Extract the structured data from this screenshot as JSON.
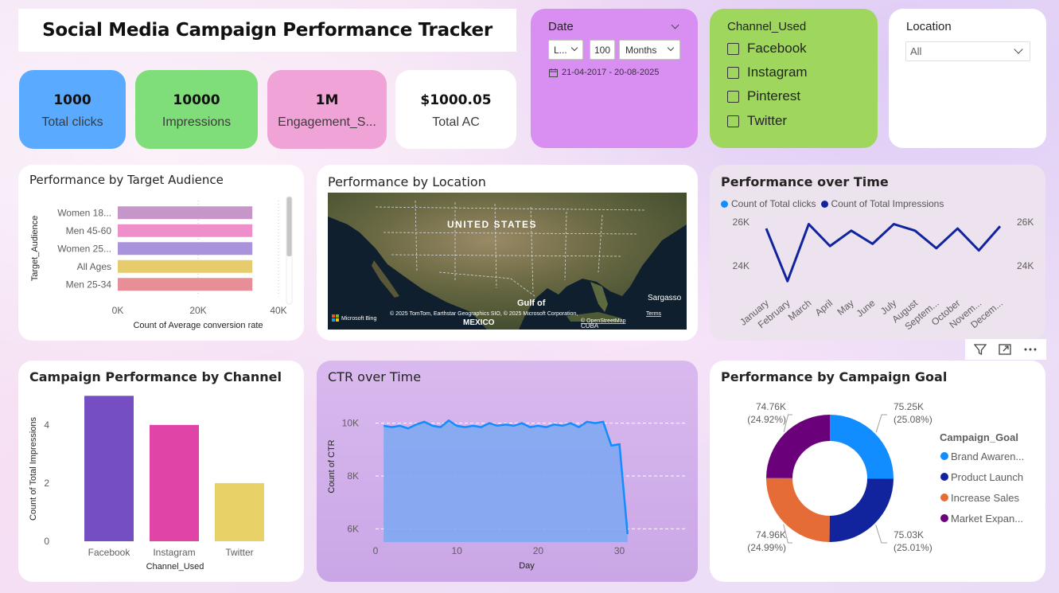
{
  "title": "Social Media Campaign Performance Tracker",
  "kpis": [
    {
      "value": "1000",
      "label": "Total clicks",
      "color": "#5aabff"
    },
    {
      "value": "10000",
      "label": "Impressions",
      "color": "#80de7a"
    },
    {
      "value": "1M",
      "label": "Engagement_S...",
      "color": "#f0a3d6"
    },
    {
      "value": "$1000.05",
      "label": "Total AC",
      "color": "#ffffff"
    }
  ],
  "date_slicer": {
    "title": "Date",
    "mode": "L...",
    "count": "100",
    "unit": "Months",
    "range": "21-04-2017 - 20-08-2025",
    "color": "#d98ff2"
  },
  "channel_slicer": {
    "title": "Channel_Used",
    "options": [
      "Facebook",
      "Instagram",
      "Pinterest",
      "Twitter"
    ],
    "color": "#9ed65e"
  },
  "location_slicer": {
    "title": "Location",
    "selected": "All"
  },
  "visual_headers": {
    "target_audience": "Performance by Target Audience",
    "location": "Performance by Location",
    "over_time": "Performance over Time",
    "channel": "Campaign Performance by Channel",
    "ctr": "CTR over Time",
    "goal": "Performance by Campaign Goal"
  },
  "map": {
    "country_label": "UNITED STATES",
    "gulf_label": "Gulf of",
    "mexico_label": "MEXICO",
    "cuba_label": "CUBA",
    "sargasso_label": "Sargasso",
    "attribution": "© 2025 TomTom, Earthstar Geographics SIO, © 2025 Microsoft Corporation,",
    "osm": "© OpenStreetMap",
    "terms": "Terms",
    "bing": "Microsoft Bing"
  },
  "visual_icons": [
    "filter-icon",
    "focus-mode-icon",
    "more-options-icon"
  ],
  "chart_data": [
    {
      "id": "target_audience",
      "type": "bar",
      "orientation": "horizontal",
      "title": "Performance by Target Audience",
      "categories": [
        "Women 18...",
        "Men 45-60",
        "Women 25...",
        "All Ages",
        "Men 25-34"
      ],
      "values": [
        33500,
        33500,
        33500,
        33500,
        33500
      ],
      "colors": [
        "#c796c9",
        "#ee8fcb",
        "#a994dc",
        "#e6cc6c",
        "#e88e97"
      ],
      "xlabel": "Count of Average conversion rate",
      "ylabel": "Target_Audience",
      "xticks": [
        "0K",
        "20K",
        "40K"
      ],
      "xlim": [
        0,
        40000
      ]
    },
    {
      "id": "over_time",
      "type": "line",
      "title": "Performance over Time",
      "categories": [
        "January",
        "February",
        "March",
        "April",
        "May",
        "June",
        "July",
        "August",
        "Septem...",
        "October",
        "Novem...",
        "Decem..."
      ],
      "series": [
        {
          "name": "Count of Total clicks",
          "color": "#118dff",
          "values": [
            25700,
            23300,
            25900,
            24900,
            25600,
            25000,
            25900,
            25600,
            24800,
            25700,
            24700,
            25800
          ]
        },
        {
          "name": "Count of Total Impressions",
          "color": "#12239e",
          "values": [
            25700,
            23300,
            25900,
            24900,
            25600,
            25000,
            25900,
            25600,
            24800,
            25700,
            24700,
            25800
          ]
        }
      ],
      "ylim": [
        22800,
        26500
      ],
      "yticks": [
        "26K",
        "24K"
      ],
      "ytick_values": [
        26000,
        24000
      ]
    },
    {
      "id": "channel",
      "type": "bar",
      "title": "Campaign Performance by Channel",
      "categories": [
        "Facebook",
        "Instagram",
        "Twitter"
      ],
      "values": [
        5,
        4,
        2
      ],
      "colors": [
        "#744ec2",
        "#e044a7",
        "#e8d166"
      ],
      "xlabel": "Channel_Used",
      "ylabel": "Count of Total Impressions",
      "ylim": [
        0,
        5.2
      ],
      "yticks": [
        0,
        2,
        4
      ]
    },
    {
      "id": "ctr",
      "type": "area",
      "title": "CTR over Time",
      "x": [
        1,
        2,
        3,
        4,
        5,
        6,
        7,
        8,
        9,
        10,
        11,
        12,
        13,
        14,
        15,
        16,
        17,
        18,
        19,
        20,
        21,
        22,
        23,
        24,
        25,
        26,
        27,
        28,
        29,
        30,
        31
      ],
      "values": [
        9900,
        9850,
        9900,
        9800,
        9950,
        10050,
        9900,
        9850,
        10100,
        9900,
        9850,
        9900,
        9850,
        10000,
        9900,
        9950,
        9900,
        10000,
        9850,
        9900,
        9850,
        9950,
        9900,
        10000,
        9850,
        10050,
        10000,
        10050,
        9150,
        9200,
        5800
      ],
      "color": "#118dff",
      "xlabel": "Day",
      "ylabel": "Count of CTR",
      "xticks": [
        0,
        10,
        20,
        30
      ],
      "yticks": [
        "10K",
        "8K",
        "6K"
      ],
      "ytick_values": [
        10000,
        8000,
        6000
      ],
      "xlim": [
        0,
        32
      ],
      "ylim": [
        5500,
        10800
      ]
    },
    {
      "id": "goal",
      "type": "pie",
      "donut": true,
      "title": "Performance by Campaign Goal",
      "legend_title": "Campaign_Goal",
      "labels": [
        "Brand Awaren...",
        "Product Launch",
        "Increase Sales",
        "Market Expan..."
      ],
      "values": [
        75250,
        75030,
        74960,
        74760
      ],
      "display": [
        "75.25K",
        "75.03K",
        "74.96K",
        "74.76K"
      ],
      "percents": [
        "(25.08%)",
        "(25.01%)",
        "(24.99%)",
        "(24.92%)"
      ],
      "colors": [
        "#118dff",
        "#12239e",
        "#e66c37",
        "#6b007b"
      ]
    }
  ]
}
